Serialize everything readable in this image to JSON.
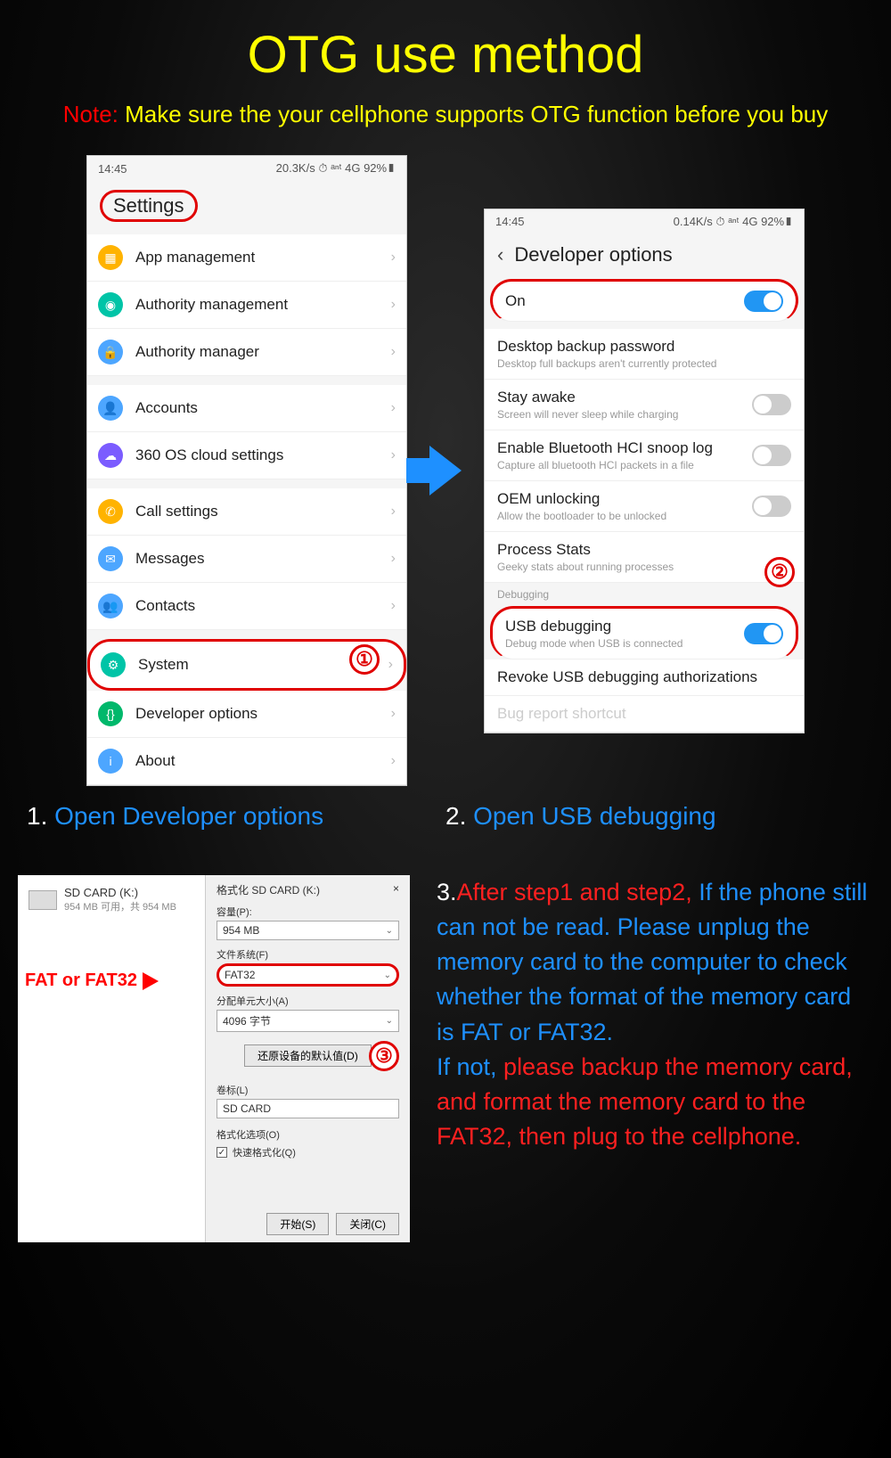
{
  "title": "OTG use method",
  "note_label": "Note:",
  "note_text": "Make sure the your cellphone supports OTG function before you buy",
  "phone1": {
    "status": {
      "time": "14:45",
      "right": "20.3K/s ⏱ ᵃⁿᵗ 4G 92%▮"
    },
    "header": "Settings",
    "items": [
      {
        "icon_color": "#ffb300",
        "label": "App management"
      },
      {
        "icon_color": "#00c4a7",
        "label": "Authority management"
      },
      {
        "icon_color": "#4da6ff",
        "label": "Authority manager"
      },
      {
        "icon_color": "#4da6ff",
        "label": "Accounts",
        "sep": true
      },
      {
        "icon_color": "#7b5cff",
        "label": "360 OS cloud settings"
      },
      {
        "icon_color": "#ffb300",
        "label": "Call settings",
        "sep": true
      },
      {
        "icon_color": "#4da6ff",
        "label": "Messages"
      },
      {
        "icon_color": "#4da6ff",
        "label": "Contacts"
      },
      {
        "icon_color": "#00c4a7",
        "label": "System",
        "sep": true,
        "highlight": true
      },
      {
        "icon_color": "#00b86b",
        "label": "Developer options"
      },
      {
        "icon_color": "#4da6ff",
        "label": "About"
      }
    ],
    "badge": "①"
  },
  "phone2": {
    "status": {
      "time": "14:45",
      "right": "0.14K/s ⏱ ᵃⁿᵗ 4G 92%▮"
    },
    "header": "Developer options",
    "on_label": "On",
    "items": [
      {
        "label": "Desktop backup password",
        "sub": "Desktop full backups aren't currently protected"
      },
      {
        "label": "Stay awake",
        "sub": "Screen will never sleep while charging",
        "toggle": "off"
      },
      {
        "label": "Enable Bluetooth HCI snoop log",
        "sub": "Capture all bluetooth HCI packets in a file",
        "toggle": "off"
      },
      {
        "label": "OEM unlocking",
        "sub": "Allow the bootloader to be unlocked",
        "toggle": "off"
      },
      {
        "label": "Process Stats",
        "sub": "Geeky stats about running processes"
      }
    ],
    "section": "Debugging",
    "usb": {
      "label": "USB debugging",
      "sub": "Debug mode when USB is connected"
    },
    "revoke": "Revoke USB debugging authorizations",
    "bug": "Bug report shortcut",
    "badge": "②"
  },
  "caption1_num": "1.",
  "caption1_text": "Open Developer options",
  "caption2_num": "2.",
  "caption2_text": "Open USB debugging",
  "format": {
    "sd_name": "SD CARD (K:)",
    "sd_sub": "954 MB 可用，共 954 MB",
    "fat_label": "FAT or FAT32",
    "dlg_title": "格式化 SD CARD (K:)",
    "close": "×",
    "capacity_label": "容量(P):",
    "capacity_val": "954 MB",
    "fs_label": "文件系统(F)",
    "fs_val": "FAT32",
    "alloc_label": "分配单元大小(A)",
    "alloc_val": "4096 字节",
    "restore_btn": "还原设备的默认值(D)",
    "vol_label": "卷标(L)",
    "vol_val": "SD CARD",
    "opts_label": "格式化选项(O)",
    "quick_label": "快速格式化(Q)",
    "start_btn": "开始(S)",
    "close_btn": "关闭(C)",
    "badge": "③"
  },
  "step3": {
    "num": "3.",
    "red1": "After step1 and step2,",
    "blue1": "If the phone still can not be read. Please unplug the memory card to the computer to check whether the format of the memory card is FAT or FAT32.",
    "blue2": "If not, ",
    "red2": "please backup the memory card, and format the memory card to the FAT32, then plug to the cellphone."
  }
}
